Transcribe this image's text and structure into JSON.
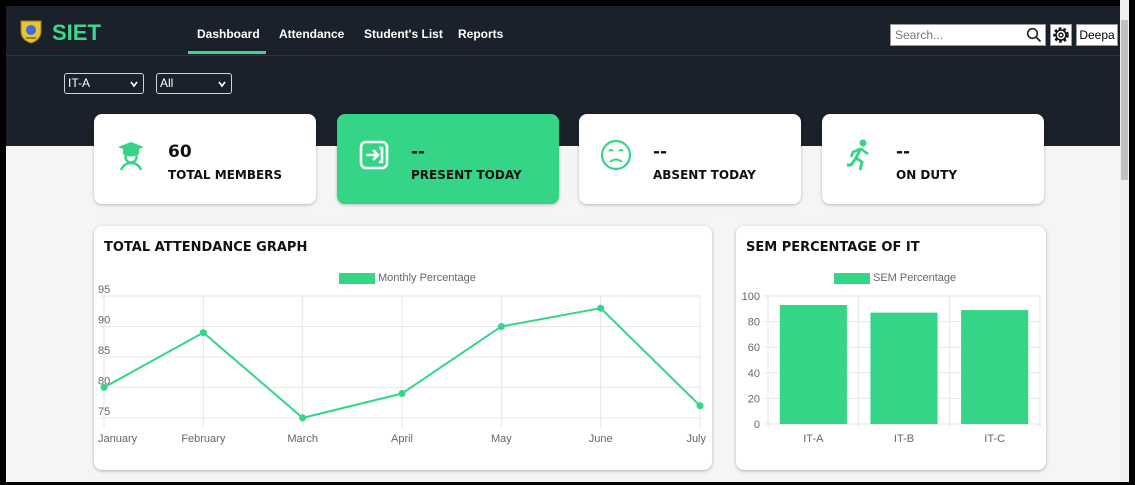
{
  "header": {
    "brand": "SIET",
    "nav": [
      "Dashboard",
      "Attendance",
      "Student's List",
      "Reports"
    ],
    "active_nav": "Dashboard",
    "search_placeholder": "Search...",
    "user": "Deepa",
    "accent": "#3dd68c",
    "bg": "#1b212b"
  },
  "filters": {
    "class_value": "IT-A",
    "scope_value": "All"
  },
  "cards": [
    {
      "value": "60",
      "label": "TOTAL MEMBERS",
      "icon": "teacher-icon"
    },
    {
      "value": "--",
      "label": "PRESENT TODAY",
      "icon": "sign-in-icon"
    },
    {
      "value": "--",
      "label": "ABSENT TODAY",
      "icon": "sad-face-icon"
    },
    {
      "value": "--",
      "label": "ON DUTY",
      "icon": "running-person-icon"
    }
  ],
  "panels": {
    "attendance_title": "TOTAL ATTENDANCE GRAPH",
    "sem_title": "SEM PERCENTAGE OF IT"
  },
  "chart_data": [
    {
      "type": "line",
      "title": "TOTAL ATTENDANCE GRAPH",
      "categories": [
        "January",
        "February",
        "March",
        "April",
        "May",
        "June",
        "July"
      ],
      "series": [
        {
          "name": "Monthly Percentage",
          "values": [
            80,
            89,
            75,
            79,
            90,
            93,
            77
          ]
        }
      ],
      "ylim": [
        74,
        95
      ],
      "yticks": [
        75,
        80,
        85,
        90,
        95
      ],
      "color": "#35d587",
      "legend": "top-center",
      "grid": true
    },
    {
      "type": "bar",
      "title": "SEM PERCENTAGE OF IT",
      "categories": [
        "IT-A",
        "IT-B",
        "IT-C"
      ],
      "series": [
        {
          "name": "SEM Percentage",
          "values": [
            93,
            87,
            89
          ]
        }
      ],
      "ylim": [
        0,
        100
      ],
      "yticks": [
        0,
        20,
        40,
        60,
        80,
        100
      ],
      "color": "#35d587",
      "legend": "top-center",
      "grid": true
    }
  ]
}
